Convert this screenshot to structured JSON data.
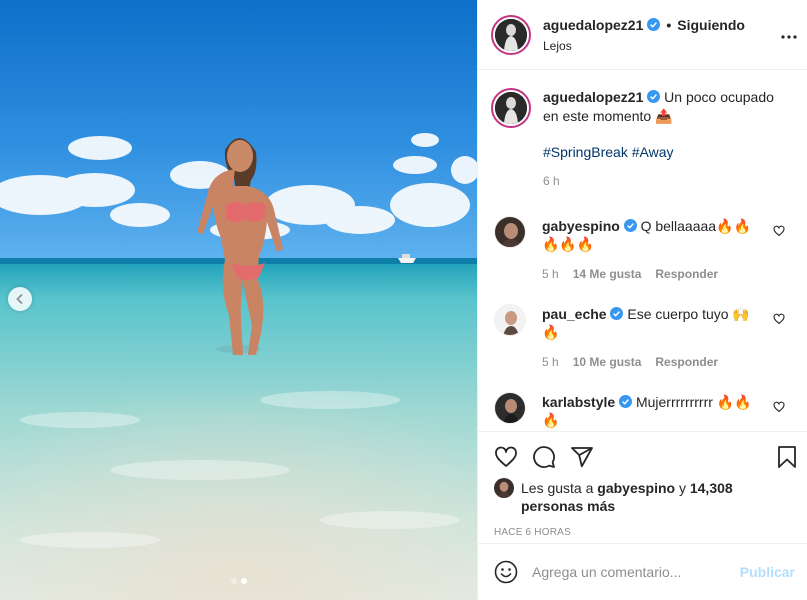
{
  "post": {
    "username": "aguedalopez21",
    "follow_status": "Siguiendo",
    "separator": "•",
    "location": "Lejos",
    "caption": "Un poco ocupado en este momento 📤",
    "hashtags": "#SpringBreak #Away",
    "caption_time": "6 h"
  },
  "comments": [
    {
      "username": "gabyespino",
      "text": "Q bellaaaaa🔥🔥🔥🔥🔥",
      "time": "5 h",
      "likes": "14 Me gusta",
      "reply": "Responder"
    },
    {
      "username": "pau_eche",
      "text": "Ese cuerpo tuyo 🙌🔥",
      "time": "5 h",
      "likes": "10 Me gusta",
      "reply": "Responder"
    },
    {
      "username": "karlabstyle",
      "text": "Mujerrrrrrrrrr 🔥🔥🔥"
    }
  ],
  "likes_summary": {
    "prefix": "Les gusta a",
    "user": "gabyespino",
    "joiner": "y",
    "others": "14,308 personas más"
  },
  "posted_ago": "Hace 6 horas",
  "add_comment": {
    "placeholder": "Agrega un comentario...",
    "post_label": "Publicar"
  },
  "icons": {
    "verified": "verified-badge-icon",
    "more": "more-options-icon",
    "like": "heart-icon",
    "comment": "comment-icon",
    "share": "paper-plane-icon",
    "save": "bookmark-icon",
    "emoji": "emoji-icon",
    "prev": "chevron-left-icon"
  },
  "colors": {
    "link": "#00376b",
    "verified": "#3897f0",
    "muted": "#8e8e8e",
    "post_disabled": "#b2dffc"
  },
  "carousel": {
    "slides": 2,
    "active": 2
  }
}
